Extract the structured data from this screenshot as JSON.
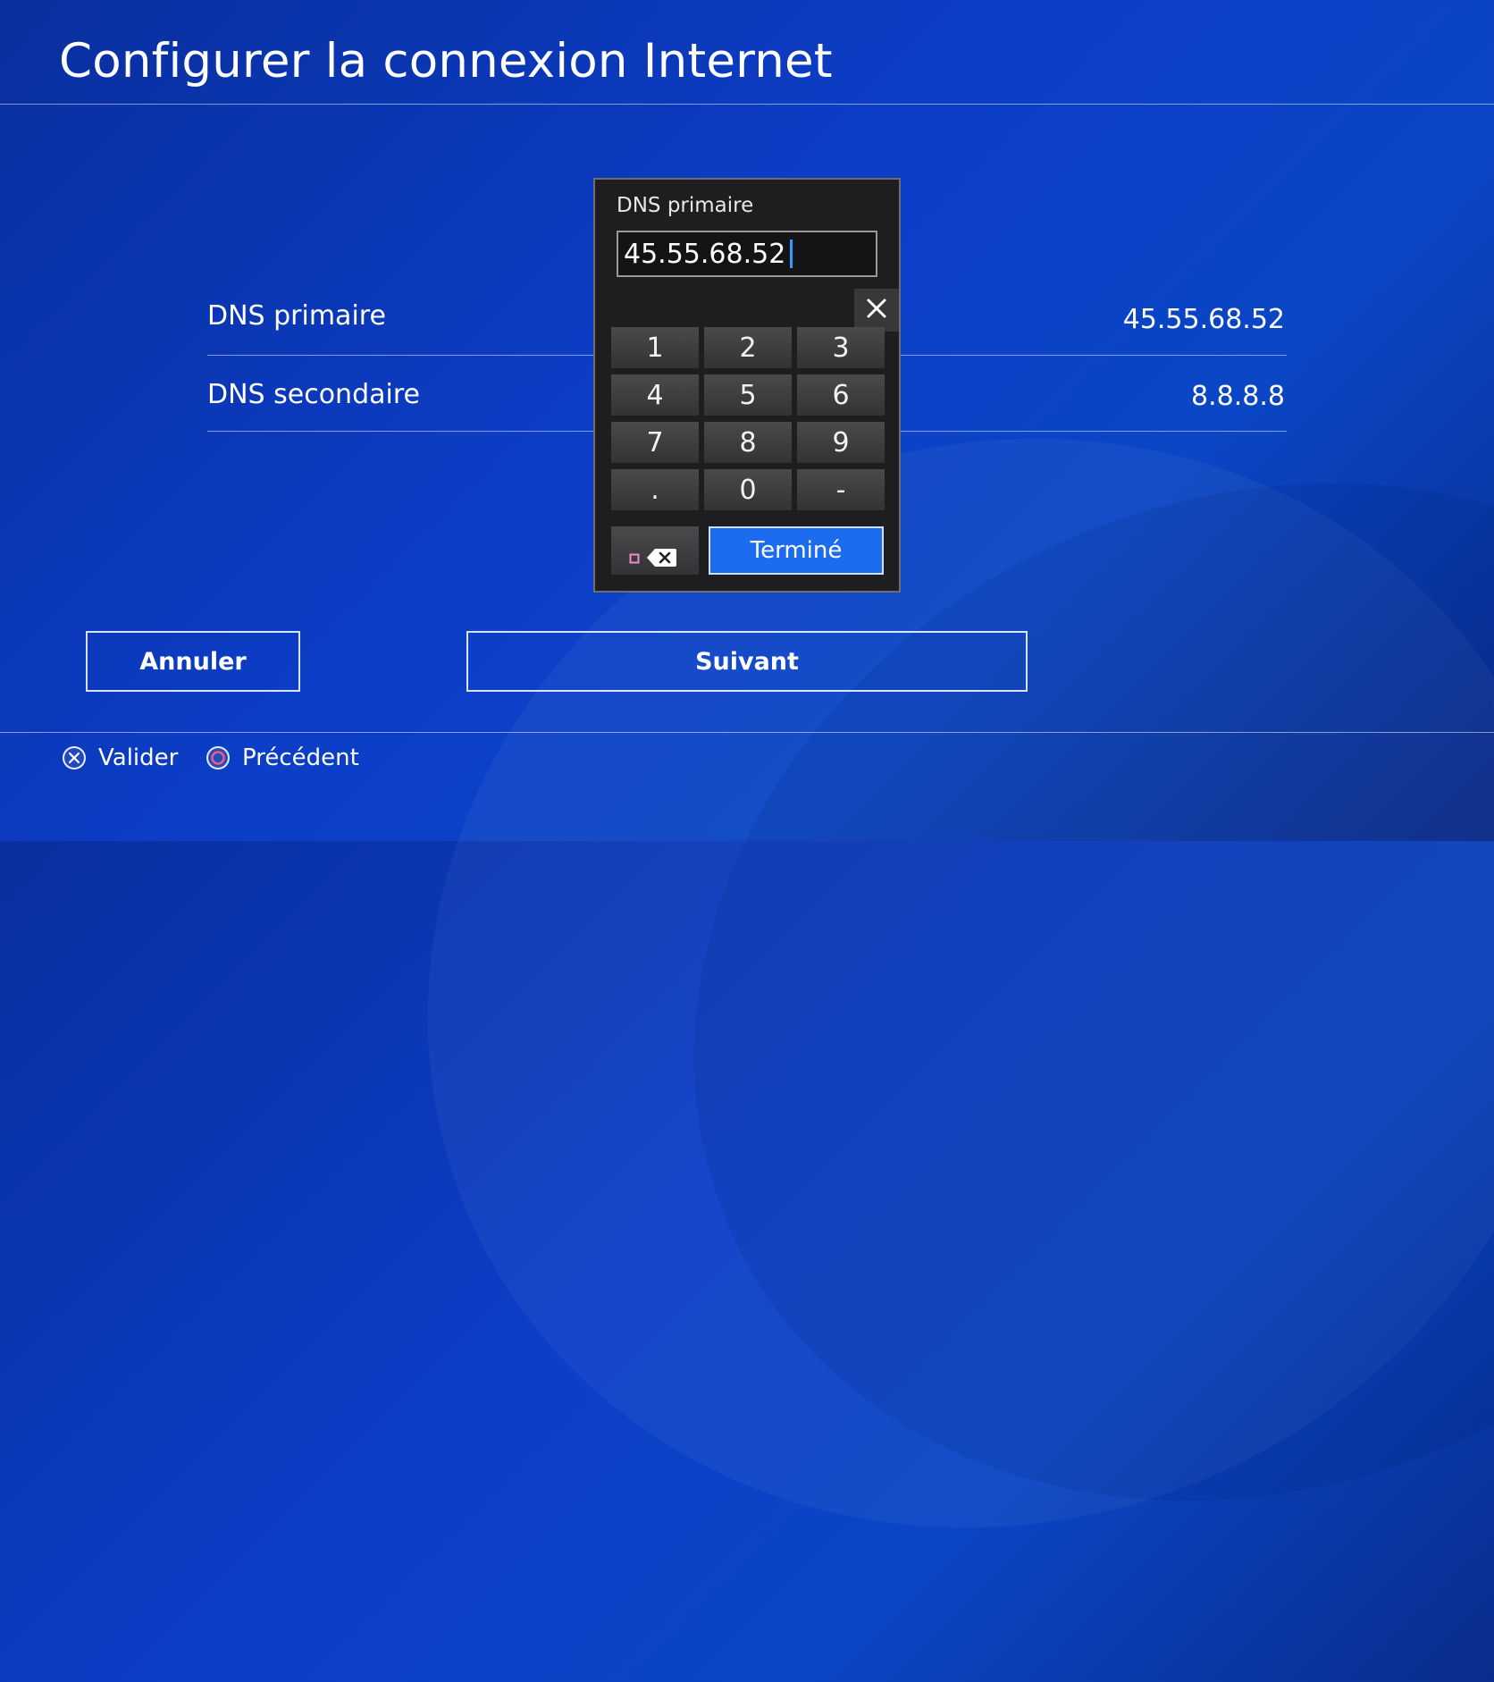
{
  "page": {
    "title": "Configurer la connexion Internet"
  },
  "settings": {
    "rows": [
      {
        "label": "DNS primaire",
        "value": "45.55.68.52"
      },
      {
        "label": "DNS secondaire",
        "value": "8.8.8.8"
      }
    ]
  },
  "buttons": {
    "cancel": "Annuler",
    "next": "Suivant"
  },
  "footer": {
    "confirm": {
      "icon": "cross-button-icon",
      "label": "Valider"
    },
    "back": {
      "icon": "circle-button-icon",
      "label": "Précédent"
    }
  },
  "dialog": {
    "label": "DNS primaire",
    "input_value": "45.55.68.52",
    "keys": [
      "1",
      "2",
      "3",
      "4",
      "5",
      "6",
      "7",
      "8",
      "9",
      ".",
      "0",
      "-"
    ],
    "done_label": "Terminé",
    "icons": {
      "close": "close-icon",
      "backspace": "backspace-icon",
      "square": "square-button-icon"
    }
  },
  "colors": {
    "accent": "#1c6cf0",
    "caret": "#2d9bff",
    "background": "#0c3ec8"
  }
}
